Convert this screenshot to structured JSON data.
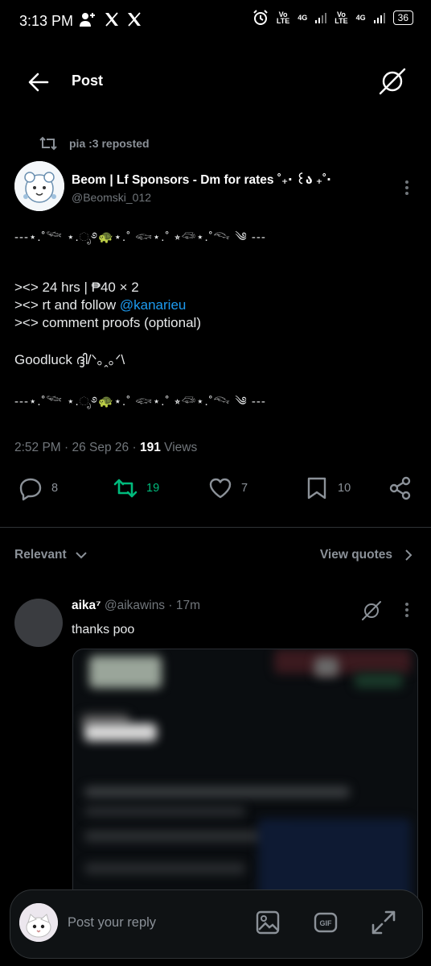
{
  "status_bar": {
    "time": "3:13 PM",
    "lte1": "Vo\nLTE",
    "net1": "4G",
    "lte2": "Vo\nLTE",
    "net2": "4G",
    "battery": "36"
  },
  "header": {
    "title": "Post"
  },
  "post": {
    "repost_text": "pia :3 reposted",
    "author_name": "Beom | Lf Sponsors - Dm for rates ˚₊‧ ꒰ა ₊˚‧",
    "author_handle": "@Beomski_012",
    "deco_line": "---⋆.˚𓆝 ⋆.ೃ࿔🐢⋆.˚ 𓆟⋆.˚ ⭒𓆛⋆.˚𓆞 ༄ ---",
    "line1": "><> 24 hrs | ₱40 × 2",
    "line2_prefix": "><> rt and follow ",
    "line2_mention": "@kanarieu",
    "line3": "><> comment proofs (optional)",
    "line4": "Goodluck ദ്ദി/ᐠ｡ꞈ｡ᐟ\\",
    "time": "2:52 PM · 26 Sep 26 · ",
    "views_count": "191",
    "views_label": " Views",
    "replies": "8",
    "reposts": "19",
    "likes": "7",
    "bookmarks": "10"
  },
  "filters": {
    "relevant": "Relevant",
    "view_quotes": "View quotes"
  },
  "reply": {
    "name": "aika⁷",
    "handle_time": " @aikawins · 17m",
    "text": "thanks poo"
  },
  "composer": {
    "placeholder": "Post your reply"
  },
  "colors": {
    "accent": "#1d9bf0",
    "repost_active": "#00ba7c",
    "background": "#000000"
  }
}
